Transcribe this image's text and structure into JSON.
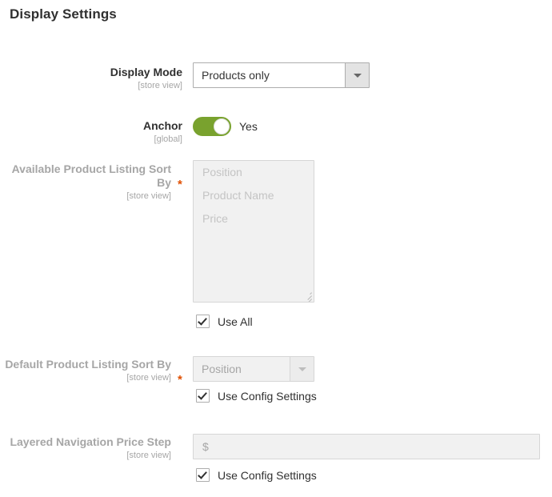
{
  "page": {
    "section_title": "Display Settings"
  },
  "fields": {
    "display_mode": {
      "label": "Display Mode",
      "scope": "[store view]",
      "value": "Products only",
      "caret_icon": "chevron-down-icon"
    },
    "anchor": {
      "label": "Anchor",
      "scope": "[global]",
      "state_label": "Yes",
      "toggle_on_color": "#79a22e"
    },
    "available_sort_by": {
      "label": "Available Product Listing Sort By",
      "scope": "[store view]",
      "required_marker": "*",
      "options": [
        "Position",
        "Product Name",
        "Price"
      ],
      "resize_grip_icon": "resize-grip-icon",
      "use_all": {
        "label": "Use All",
        "checked": true,
        "check_icon": "checkmark-icon"
      }
    },
    "default_sort_by": {
      "label": "Default Product Listing Sort By",
      "scope": "[store view]",
      "required_marker": "*",
      "value": "Position",
      "caret_icon": "chevron-down-icon",
      "use_config": {
        "label": "Use Config Settings",
        "checked": true,
        "check_icon": "checkmark-icon"
      }
    },
    "price_step": {
      "label": "Layered Navigation Price Step",
      "scope": "[store view]",
      "prefix": "$",
      "value": "",
      "use_config": {
        "label": "Use Config Settings",
        "checked": true,
        "check_icon": "checkmark-icon"
      }
    }
  },
  "colors": {
    "required_asterisk": "#e04f00",
    "label_enabled": "#303030",
    "label_disabled": "#a6a6a6",
    "toggle_on": "#79a22e"
  }
}
